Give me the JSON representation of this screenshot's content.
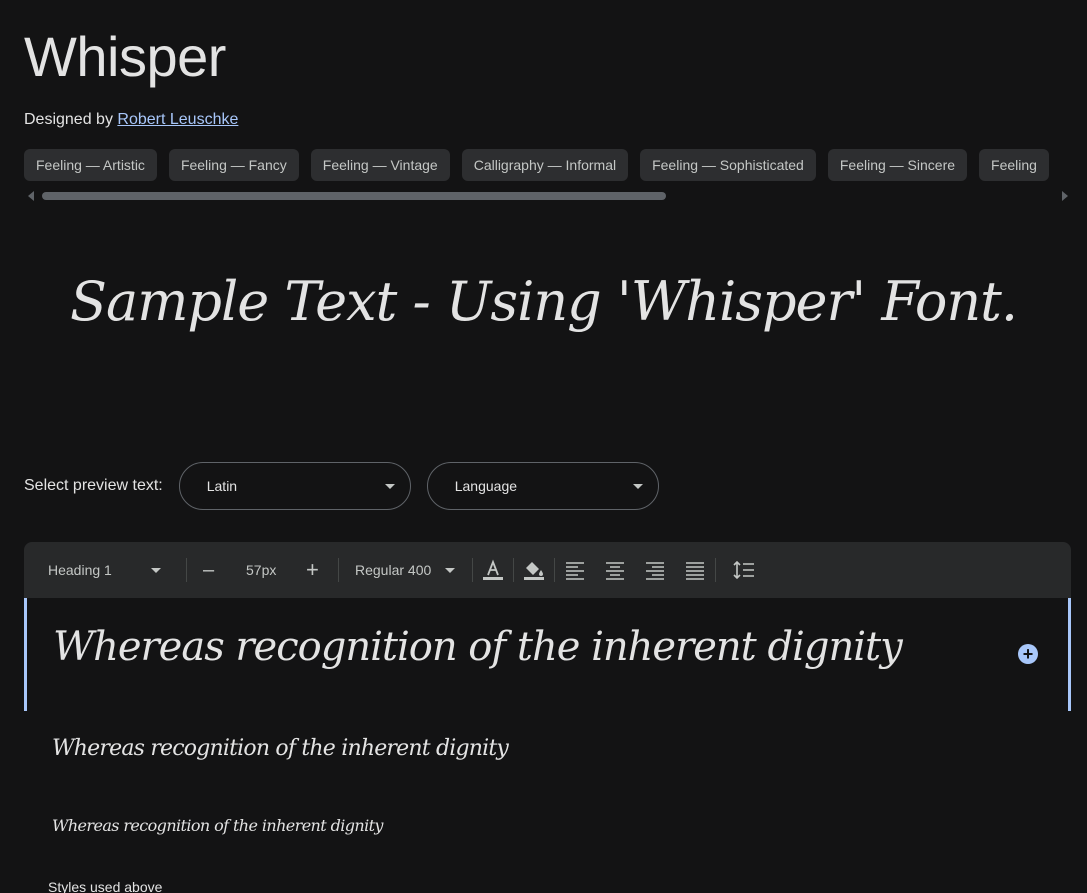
{
  "font": {
    "title": "Whisper",
    "designed_by_label": "Designed by",
    "designer": "Robert Leuschke"
  },
  "tags": [
    "Feeling — Artistic",
    "Feeling — Fancy",
    "Feeling — Vintage",
    "Calligraphy — Informal",
    "Feeling — Sophisticated",
    "Feeling — Sincere",
    "Feeling"
  ],
  "hero": {
    "text": "Sample Text - Using 'Whisper' Font."
  },
  "preview": {
    "label": "Select preview text:",
    "script_select": "Latin",
    "language_select": "Language"
  },
  "toolbar": {
    "style": "Heading 1",
    "size": "57px",
    "weight": "Regular 400",
    "decrease_label": "–",
    "increase_label": "+"
  },
  "samples": [
    "Whereas recognition of the inherent dignity",
    "Whereas recognition of the inherent dignity",
    "Whereas recognition of the inherent dignity"
  ],
  "styles_used_label": "Styles used above",
  "colors": {
    "background": "#131314",
    "toolbar": "#28292a",
    "accent": "#a8c7fa",
    "chip": "#2d2e30"
  }
}
